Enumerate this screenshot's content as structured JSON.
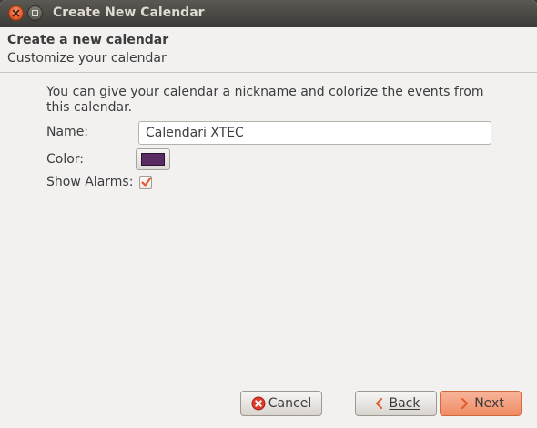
{
  "window": {
    "title": "Create New Calendar",
    "buttons": {
      "close": "close-icon",
      "maximize": "maximize-icon"
    }
  },
  "header": {
    "title": "Create a new calendar",
    "subtitle": "Customize your calendar"
  },
  "form": {
    "description": "You can give your calendar a nickname and colorize the events from this calendar.",
    "name_label": "Name:",
    "name_value": "Calendari XTEC",
    "color_label": "Color:",
    "color_value": "#5a2a63",
    "alarms_label": "Show Alarms:",
    "alarms_checked": true
  },
  "footer": {
    "cancel_label": "Cancel",
    "back_label": "Back",
    "next_label": "Next",
    "icons": {
      "cancel": "cancel-icon",
      "back": "back-arrow-icon",
      "next": "next-arrow-icon"
    }
  },
  "colors": {
    "accent": "#e2592a",
    "titlebar": "#3c3b37"
  }
}
